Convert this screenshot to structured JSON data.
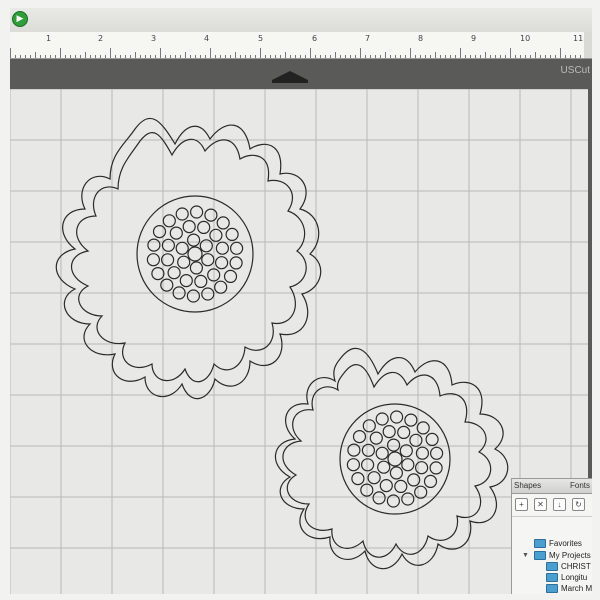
{
  "app": {
    "title_fragment": "USCut",
    "icon_name": "app-logo-icon"
  },
  "ruler": {
    "numbers": [
      "1",
      "2",
      "3",
      "4",
      "5",
      "6",
      "7",
      "8",
      "9",
      "10",
      "11"
    ]
  },
  "mat": {
    "background_color": "#e8e8e6",
    "grid_color": "#b9b9b9",
    "outline_color": "#2a2a2a"
  },
  "shapes_panel": {
    "tabs": [
      "Shapes",
      "Fonts"
    ],
    "tool_icons": [
      "new-folder-icon",
      "delete-icon",
      "import-icon",
      "refresh-icon"
    ],
    "tree": [
      {
        "label": "Favorites",
        "level": 0
      },
      {
        "label": "My Projects",
        "level": 0
      },
      {
        "label": "CHRIST",
        "level": 1
      },
      {
        "label": "Longitu",
        "level": 1
      },
      {
        "label": "March M",
        "level": 1
      }
    ]
  }
}
